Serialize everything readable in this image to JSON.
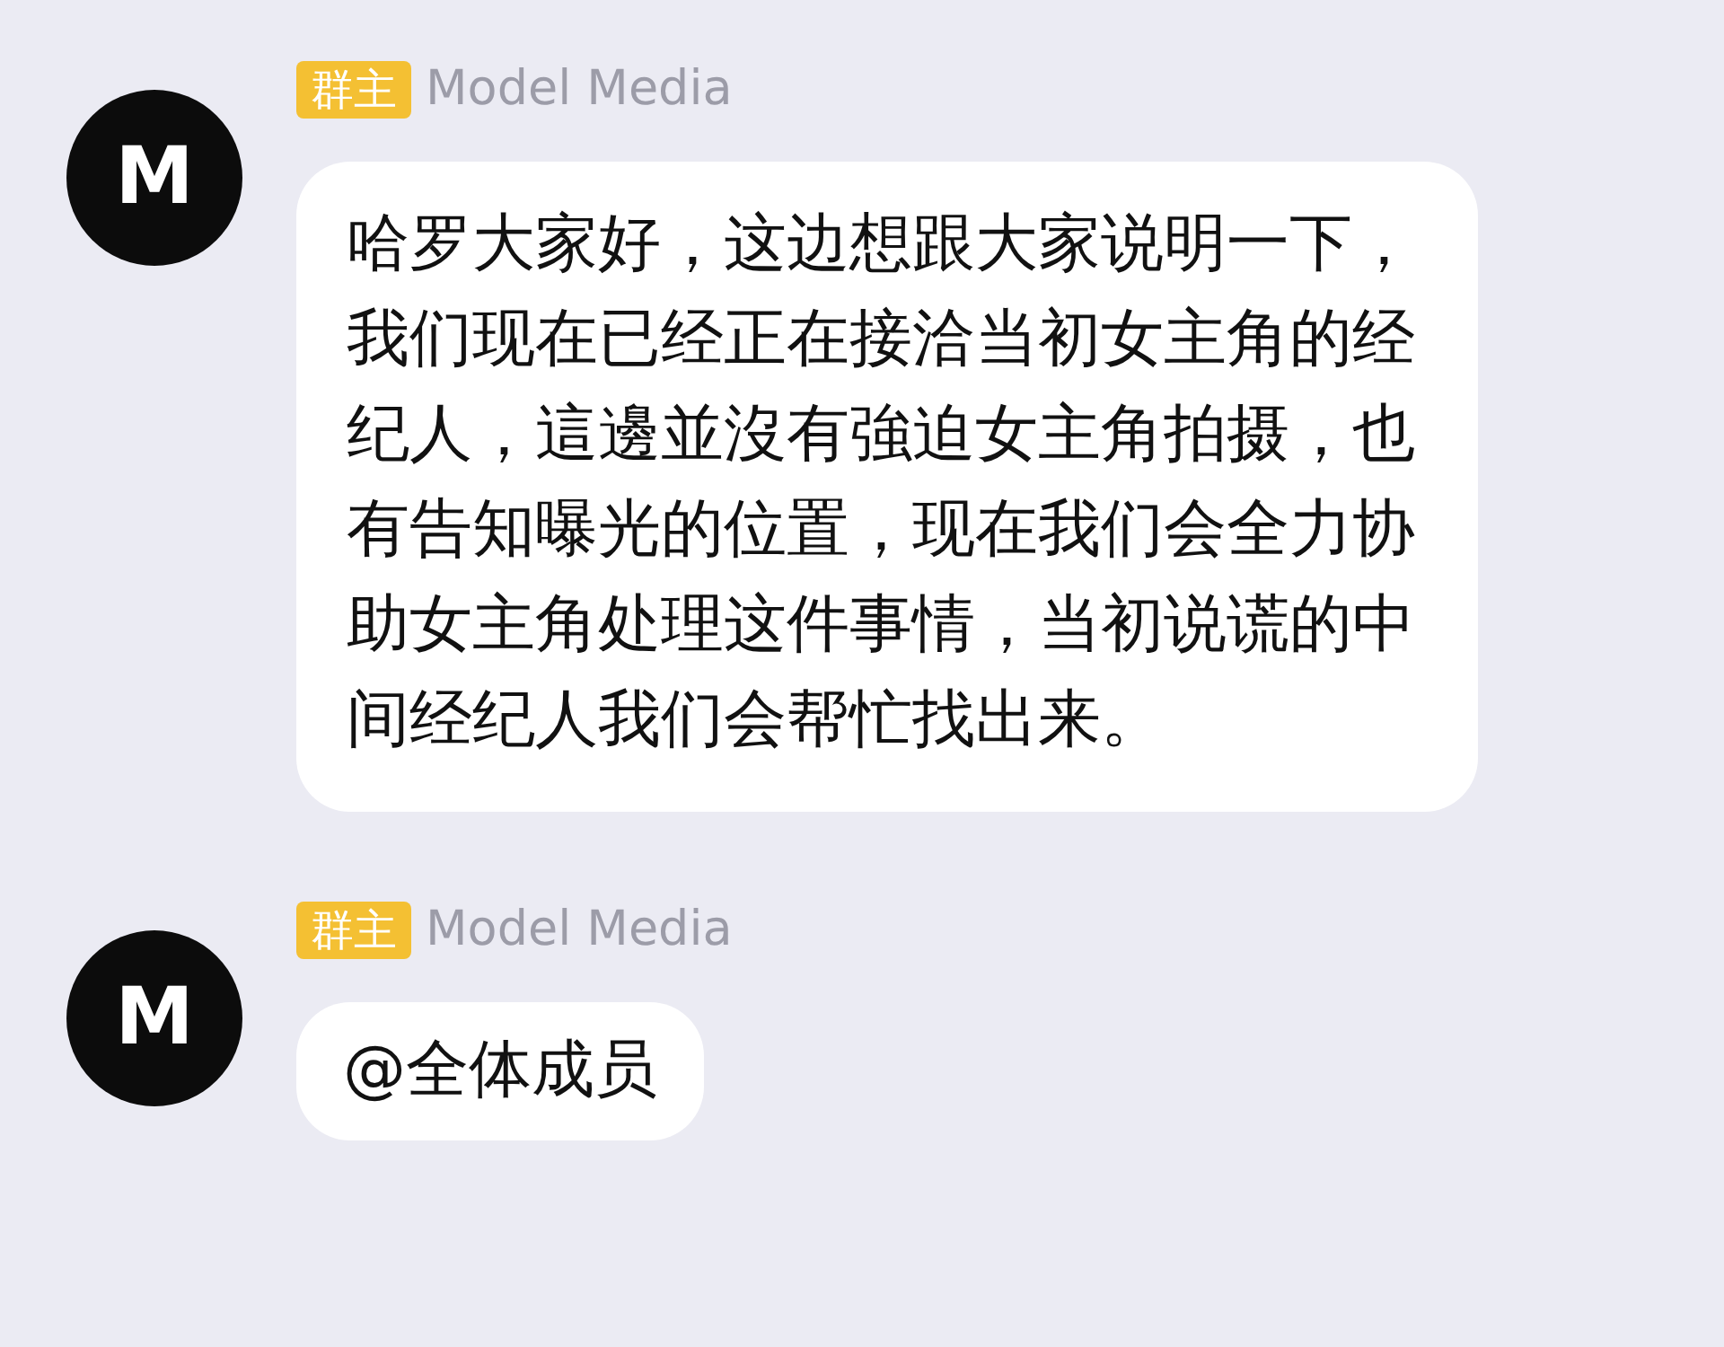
{
  "messages": [
    {
      "avatar_label": "M",
      "role_badge": "群主",
      "sender": "Model Media",
      "text": "哈罗大家好，这边想跟大家说明一下，我们现在已经正在接洽当初女主角的经纪人，這邊並沒有強迫女主角拍摄，也有告知曝光的位置，现在我们会全力协助女主角处理这件事情，当初说谎的中间经纪人我们会帮忙找出来。"
    },
    {
      "avatar_label": "M",
      "role_badge": "群主",
      "sender": "Model Media",
      "text": "@全体成员"
    }
  ]
}
